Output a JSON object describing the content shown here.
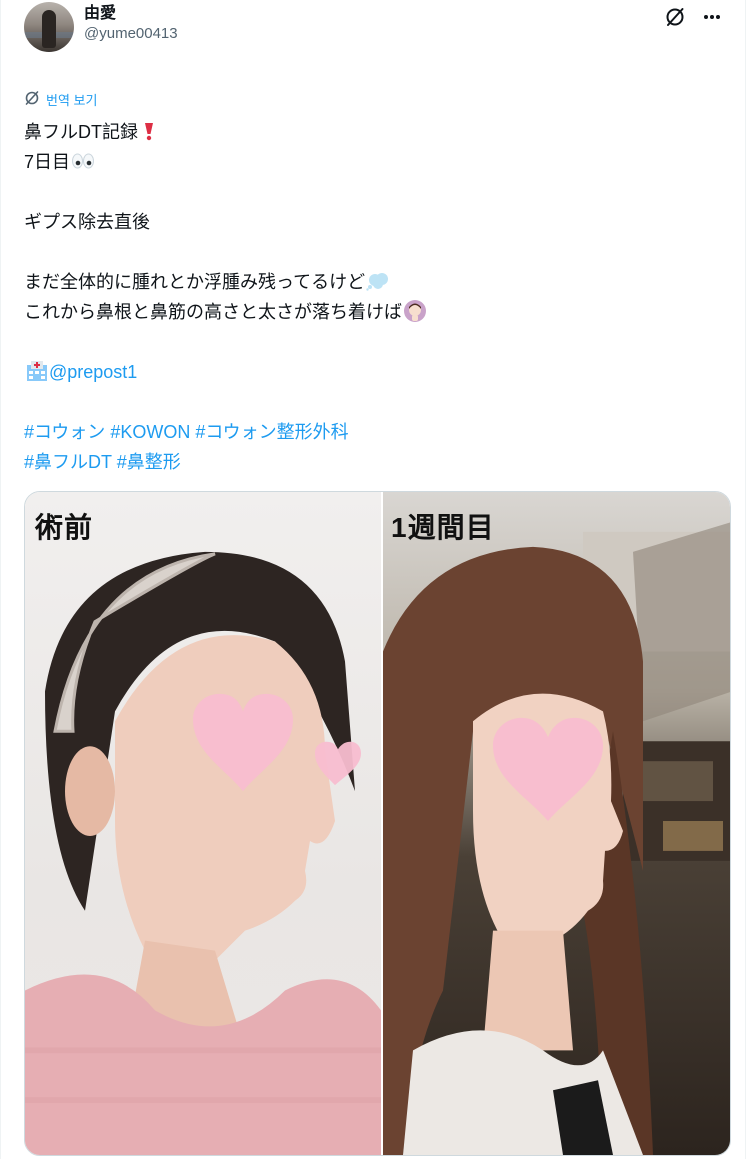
{
  "author": {
    "display_name": "由愛",
    "handle": "@yume00413"
  },
  "header": {
    "grok_icon": "grok-icon",
    "more_icon": "more-dots-icon"
  },
  "translate": {
    "label": "번역 보기",
    "icon": "translate-icon"
  },
  "tweet": {
    "line1": "鼻フルDT記録",
    "line1_emoji": "red-exclamation-emoji",
    "line2": "7日目",
    "line2_emoji": "eyes-emoji",
    "line3": "ギプス除去直後",
    "line4": "まだ全体的に腫れとか浮腫み残ってるけど",
    "line4_emoji": "thought-bubble-emoji",
    "line5": "これから鼻根と鼻筋の高さと太さが落ち着けば",
    "line5_emoji": "praying-woman-emoji",
    "mention_emoji": "hospital-emoji",
    "mention": "@prepost1",
    "hashtags_line1": [
      "#コウォン",
      "#KOWON",
      "#コウォン整形外科"
    ],
    "hashtags_line2": [
      "#鼻フルDT",
      "#鼻整形"
    ]
  },
  "media": {
    "left_label": "術前",
    "right_label": "1週間目"
  },
  "colors": {
    "link": "#1d9bf0",
    "text": "#0f1419",
    "secondary": "#536471",
    "heart": "#f7b3c8"
  }
}
